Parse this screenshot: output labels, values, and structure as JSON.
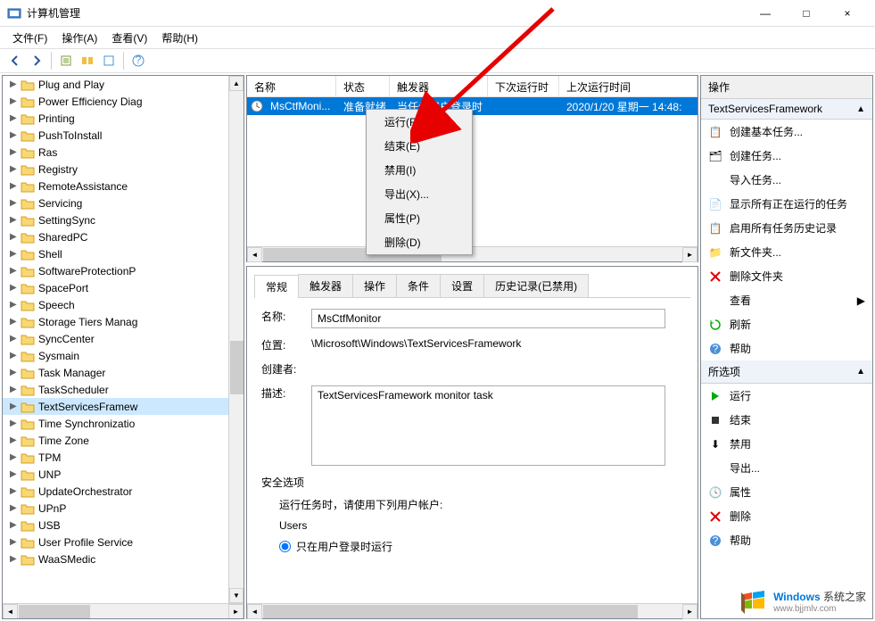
{
  "window": {
    "title": "计算机管理",
    "minimize": "—",
    "maximize": "□",
    "close": "×"
  },
  "menu": {
    "file": "文件(F)",
    "action": "操作(A)",
    "view": "查看(V)",
    "help": "帮助(H)"
  },
  "tree": {
    "items": [
      "Plug and Play",
      "Power Efficiency Diag",
      "Printing",
      "PushToInstall",
      "Ras",
      "Registry",
      "RemoteAssistance",
      "Servicing",
      "SettingSync",
      "SharedPC",
      "Shell",
      "SoftwareProtectionP",
      "SpacePort",
      "Speech",
      "Storage Tiers Manag",
      "SyncCenter",
      "Sysmain",
      "Task Manager",
      "TaskScheduler",
      "TextServicesFramew",
      "Time Synchronizatio",
      "Time Zone",
      "TPM",
      "UNP",
      "UpdateOrchestrator",
      "UPnP",
      "USB",
      "User Profile Service",
      "WaaSMedic"
    ],
    "selected_index": 19
  },
  "task_list": {
    "columns": {
      "name": "名称",
      "status": "状态",
      "triggers": "触发器",
      "next_run": "下次运行时间",
      "last_run": "上次运行时间"
    },
    "row": {
      "name": "MsCtfMoni...",
      "status": "准备就绪",
      "triggers": "当任何用户登录时",
      "next_run": "",
      "last_run": "2020/1/20 星期一 14:48:"
    }
  },
  "context_menu": {
    "run": "运行(R)",
    "end": "结束(E)",
    "disable": "禁用(I)",
    "export": "导出(X)...",
    "properties": "属性(P)",
    "delete": "删除(D)"
  },
  "detail": {
    "tabs": {
      "general": "常规",
      "triggers": "触发器",
      "actions": "操作",
      "conditions": "条件",
      "settings": "设置",
      "history": "历史记录(已禁用)"
    },
    "name_label": "名称:",
    "name_value": "MsCtfMonitor",
    "location_label": "位置:",
    "location_value": "\\Microsoft\\Windows\\TextServicesFramework",
    "creator_label": "创建者:",
    "creator_value": "",
    "description_label": "描述:",
    "description_value": "TextServicesFramework monitor task",
    "security_title": "安全选项",
    "run_as_label": "运行任务时，请使用下列用户帐户:",
    "user_account": "Users",
    "radio_logged_on": "只在用户登录时运行"
  },
  "actions": {
    "header": "操作",
    "group1": "TextServicesFramework",
    "create_basic": "创建基本任务...",
    "create_task": "创建任务...",
    "import_task": "导入任务...",
    "show_running": "显示所有正在运行的任务",
    "enable_history": "启用所有任务历史记录",
    "new_folder": "新文件夹...",
    "delete_folder": "删除文件夹",
    "view": "查看",
    "refresh": "刷新",
    "help": "帮助",
    "group2": "所选项",
    "run": "运行",
    "end": "结束",
    "disable": "禁用",
    "export": "导出...",
    "properties": "属性",
    "delete": "删除",
    "help2": "帮助"
  },
  "watermark": {
    "brand": "Windows",
    "suffix": "系统之家",
    "url": "www.bjjmlv.com"
  }
}
